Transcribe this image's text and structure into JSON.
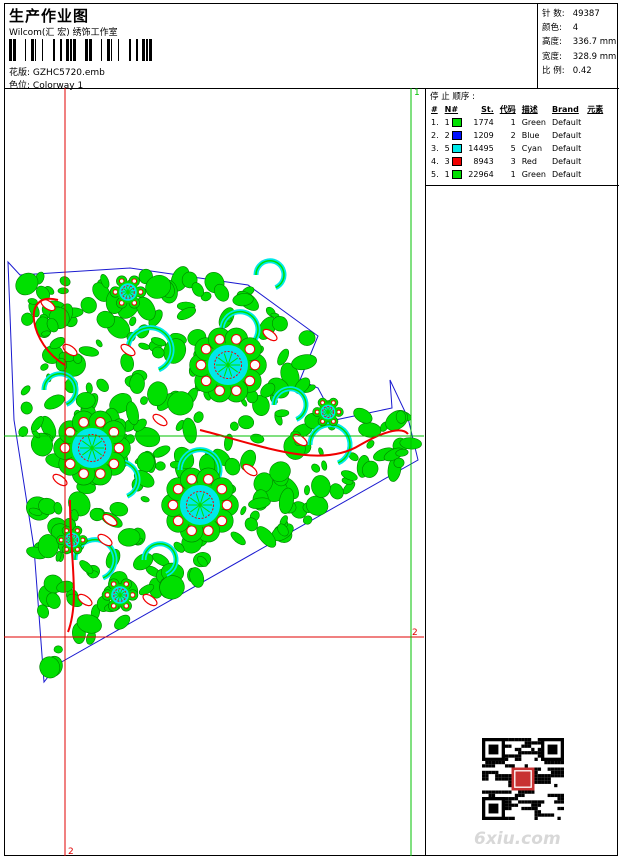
{
  "header": {
    "title": "生产作业图",
    "subtitle": "Wilcom(汇 宏) 绣饰工作室",
    "file_label": "花版:",
    "file_value": "GZHC5720.emb",
    "colorway_label": "色位:",
    "colorway_value": "Colorway 1"
  },
  "stats": {
    "stitches_label": "针 数:",
    "stitches_value": "49387",
    "colors_label": "颜色:",
    "colors_value": "4",
    "height_label": "高度:",
    "height_value": "336.7 mm",
    "width_label": "宽度:",
    "width_value": "328.9 mm",
    "scale_label": "比 例:",
    "scale_value": "0.42"
  },
  "sequence": {
    "title": "停 止 顺序 :",
    "headers": [
      "#",
      "N#",
      "St.",
      "代码",
      "描述",
      "Brand",
      "元素"
    ],
    "rows": [
      {
        "idx": "1.",
        "n": "1",
        "color": "#00e000",
        "st": "1774",
        "code": "1",
        "desc": "Green",
        "brand": "Default"
      },
      {
        "idx": "2.",
        "n": "2",
        "color": "#0010ff",
        "st": "1209",
        "code": "2",
        "desc": "Blue",
        "brand": "Default"
      },
      {
        "idx": "3.",
        "n": "5",
        "color": "#00e8e8",
        "st": "14495",
        "code": "5",
        "desc": "Cyan",
        "brand": "Default"
      },
      {
        "idx": "4.",
        "n": "3",
        "color": "#f00000",
        "st": "8943",
        "code": "3",
        "desc": "Red",
        "brand": "Default"
      },
      {
        "idx": "5.",
        "n": "1",
        "color": "#00e000",
        "st": "22964",
        "code": "1",
        "desc": "Green",
        "brand": "Default"
      }
    ]
  },
  "markers": {
    "top_green": "1",
    "right_red": "2",
    "bottom_red": "2"
  },
  "watermark": "6xiu.com",
  "colors": {
    "green": "#00e000",
    "cyan": "#00e8e8",
    "red": "#f00000",
    "blue": "#0010ff",
    "outline": "#1a1ad0",
    "guide_red": "#e00000",
    "guide_green": "#00c000"
  }
}
